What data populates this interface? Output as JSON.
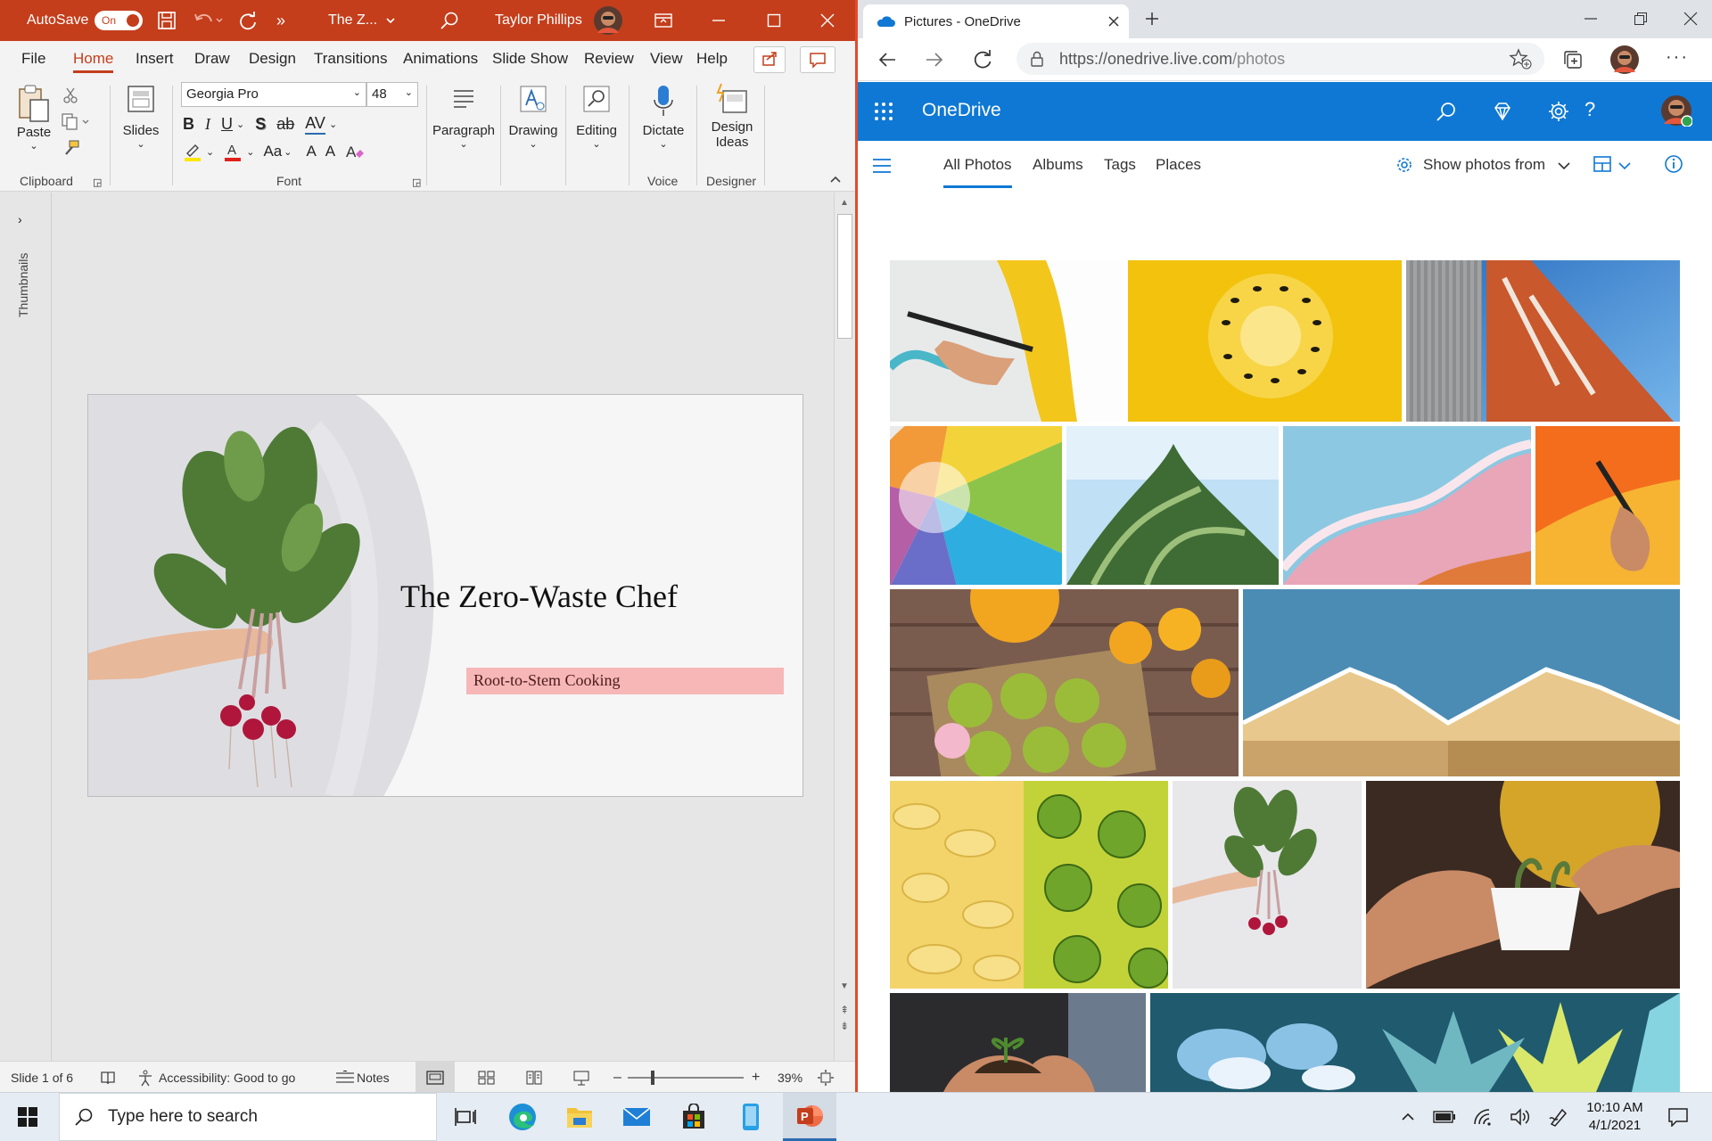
{
  "powerpoint": {
    "autosave_label": "AutoSave",
    "autosave_state": "On",
    "doc_title": "The Z...",
    "user_name": "Taylor Phillips",
    "tabs": [
      "File",
      "Home",
      "Insert",
      "Draw",
      "Design",
      "Transitions",
      "Animations",
      "Slide Show",
      "Review",
      "View",
      "Help"
    ],
    "ribbon": {
      "paste": "Paste",
      "clipboard": "Clipboard",
      "slides": "Slides",
      "font_name": "Georgia Pro",
      "font_size": "48",
      "font": "Font",
      "paragraph": "Paragraph",
      "drawing": "Drawing",
      "editing": "Editing",
      "dictate": "Dictate",
      "voice": "Voice",
      "design_ideas_1": "Design",
      "design_ideas_2": "Ideas",
      "designer": "Designer",
      "bold": "B",
      "italic": "I",
      "underline": "U",
      "shadow": "S",
      "strike": "ab",
      "spacing": "AV",
      "case": "Aa",
      "grow": "A",
      "shrink": "A"
    },
    "thumbnails_label": "Thumbnails",
    "slide": {
      "title": "The Zero-Waste Chef",
      "subtitle": "Root-to-Stem Cooking"
    },
    "status": {
      "slide_count": "Slide 1 of 6",
      "accessibility": "Accessibility: Good to go",
      "notes": "Notes",
      "zoom": "39%"
    }
  },
  "edge": {
    "tab_title": "Pictures - OneDrive",
    "url_host": "https://onedrive.live.com",
    "url_path": "/photos",
    "app_name": "OneDrive",
    "nav": [
      "All Photos",
      "Albums",
      "Tags",
      "Places"
    ],
    "show_photos_from": "Show photos from"
  },
  "taskbar": {
    "search_placeholder": "Type here to search",
    "time": "10:10 AM",
    "date": "4/1/2021"
  },
  "colors": {
    "ppt_accent": "#c43e1c",
    "onedrive_blue": "#0f78d4",
    "subtitle_highlight": "#f7b7b7"
  }
}
